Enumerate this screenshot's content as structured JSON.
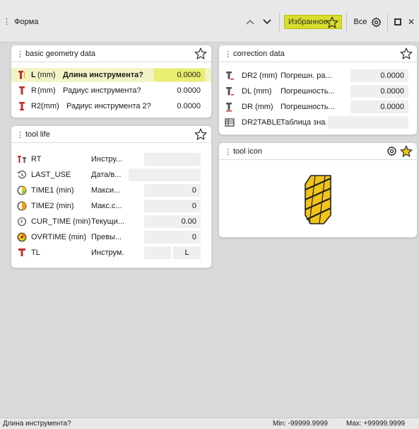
{
  "header": {
    "title": "Форма",
    "favorites_label": "Избранное",
    "all_label": "Все"
  },
  "colors": {
    "accent": "#d7dd2a",
    "tool_yellow": "#f2c418",
    "tool_red": "#c0312b"
  },
  "basic_geometry": {
    "title": "basic geometry data",
    "rows": [
      {
        "name": "L",
        "unit": "(mm)",
        "desc": "Длина инструмента?",
        "value": "0.0000"
      },
      {
        "name": "R",
        "unit": "(mm)",
        "desc": "Радиус инструмента?",
        "value": "0.0000"
      },
      {
        "name": "R2",
        "unit": "(mm)",
        "desc": "Радиус инструмента 2?",
        "value": "0.0000"
      }
    ]
  },
  "tool_life": {
    "title": "tool life",
    "rows": [
      {
        "name": "RT",
        "desc": "Инстру...",
        "value": ""
      },
      {
        "name": "LAST_USE",
        "desc": "Дата/в...",
        "value": ""
      },
      {
        "name": "TIME1 (min)",
        "desc": "Макси...",
        "value": "0"
      },
      {
        "name": "TIME2 (min)",
        "desc": "Макс.с...",
        "value": "0"
      },
      {
        "name": "CUR_TIME (min)",
        "desc": "Текущи...",
        "value": "0.00"
      },
      {
        "name": "OVRTIME (min)",
        "desc": "Превы...",
        "value": "0"
      },
      {
        "name": "TL",
        "desc": "Инструм.",
        "value": "L"
      }
    ]
  },
  "correction": {
    "title": "correction data",
    "rows": [
      {
        "name": "DR2 (mm)",
        "desc": "Погрешн. ра...",
        "value": "0.0000"
      },
      {
        "name": "DL (mm)",
        "desc": "Погрешность...",
        "value": "0.0000"
      },
      {
        "name": "DR (mm)",
        "desc": "Погрешность...",
        "value": "0.0000"
      },
      {
        "name": "DR2TABLE",
        "desc": "Таблица зна...",
        "value": ""
      }
    ]
  },
  "tool_icon": {
    "title": "tool icon"
  },
  "status": {
    "message": "Длина инструмента?",
    "min": "Min: -99999.9999",
    "max": "Max: +99999.9999"
  }
}
